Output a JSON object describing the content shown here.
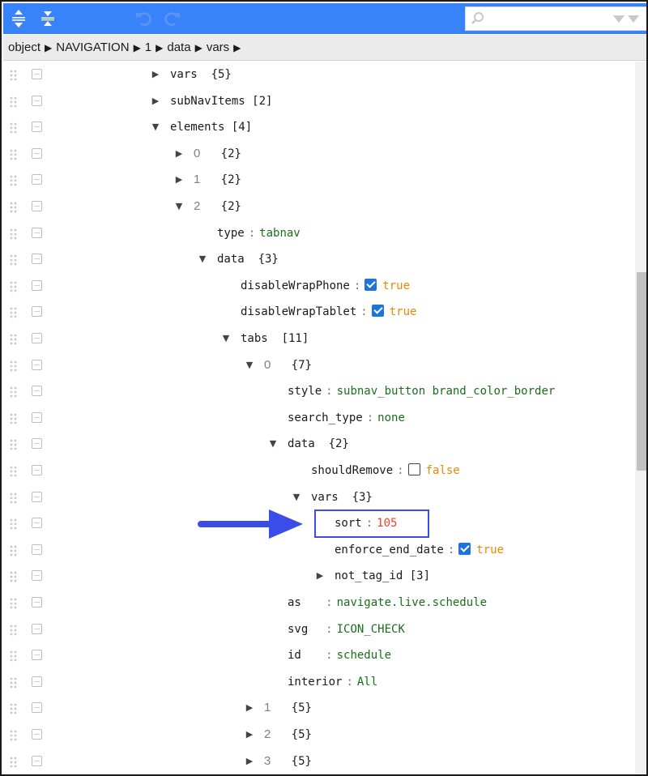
{
  "toolbar": {
    "search": {
      "value": "",
      "placeholder": ""
    }
  },
  "breadcrumb": [
    "object",
    "NAVIGATION",
    "1",
    "data",
    "vars"
  ],
  "tree": {
    "vars_node": {
      "key": "vars",
      "count": "{5}"
    },
    "subnav_node": {
      "key": "subNavItems",
      "count": "[2]"
    },
    "elements_node": {
      "key": "elements",
      "count": "[4]"
    },
    "el0": {
      "key": "0",
      "count": "{2}"
    },
    "el1": {
      "key": "1",
      "count": "{2}"
    },
    "el2": {
      "key": "2",
      "count": "{2}"
    },
    "el2_type": {
      "key": "type",
      "value": "tabnav"
    },
    "el2_data": {
      "key": "data",
      "count": "{3}"
    },
    "disable_wrap_phone": {
      "key": "disableWrapPhone",
      "value": "true",
      "checked": true
    },
    "disable_wrap_tablet": {
      "key": "disableWrapTablet",
      "value": "true",
      "checked": true
    },
    "tabs": {
      "key": "tabs",
      "count": "[11]"
    },
    "tab0": {
      "key": "0",
      "count": "{7}"
    },
    "tab0_style": {
      "key": "style",
      "value": "subnav_button brand_color_border"
    },
    "tab0_search_type": {
      "key": "search_type",
      "value": "none"
    },
    "tab0_data": {
      "key": "data",
      "count": "{2}"
    },
    "should_remove": {
      "key": "shouldRemove",
      "value": "false",
      "checked": false
    },
    "tab0_vars": {
      "key": "vars",
      "count": "{3}"
    },
    "sort": {
      "key": "sort",
      "value": "105"
    },
    "enforce_end_date": {
      "key": "enforce_end_date",
      "value": "true",
      "checked": true
    },
    "not_tag_id": {
      "key": "not_tag_id",
      "count": "[3]"
    },
    "tab0_as": {
      "key": "as",
      "value": "navigate.live.schedule"
    },
    "tab0_svg": {
      "key": "svg",
      "value": "ICON_CHECK"
    },
    "tab0_id": {
      "key": "id",
      "value": "schedule"
    },
    "tab0_interior": {
      "key": "interior",
      "value": "All"
    },
    "tab1": {
      "key": "1",
      "count": "{5}"
    },
    "tab2": {
      "key": "2",
      "count": "{5}"
    },
    "tab3": {
      "key": "3",
      "count": "{5}"
    }
  },
  "colors": {
    "menubar": "#3883fa",
    "string_value": "#1a6e1a",
    "boolean_value": "#ee8600",
    "number_value": "#ee422e",
    "annotation": "#3a4de8"
  },
  "icons": {
    "expand_all": "expand-all-icon",
    "collapse_all": "collapse-all-icon",
    "undo": "undo-icon",
    "redo": "redo-icon",
    "search": "search-icon",
    "search_options": "search-dropdown-icon",
    "drag": "drag-handle-icon",
    "context_menu": "context-menu-icon"
  }
}
